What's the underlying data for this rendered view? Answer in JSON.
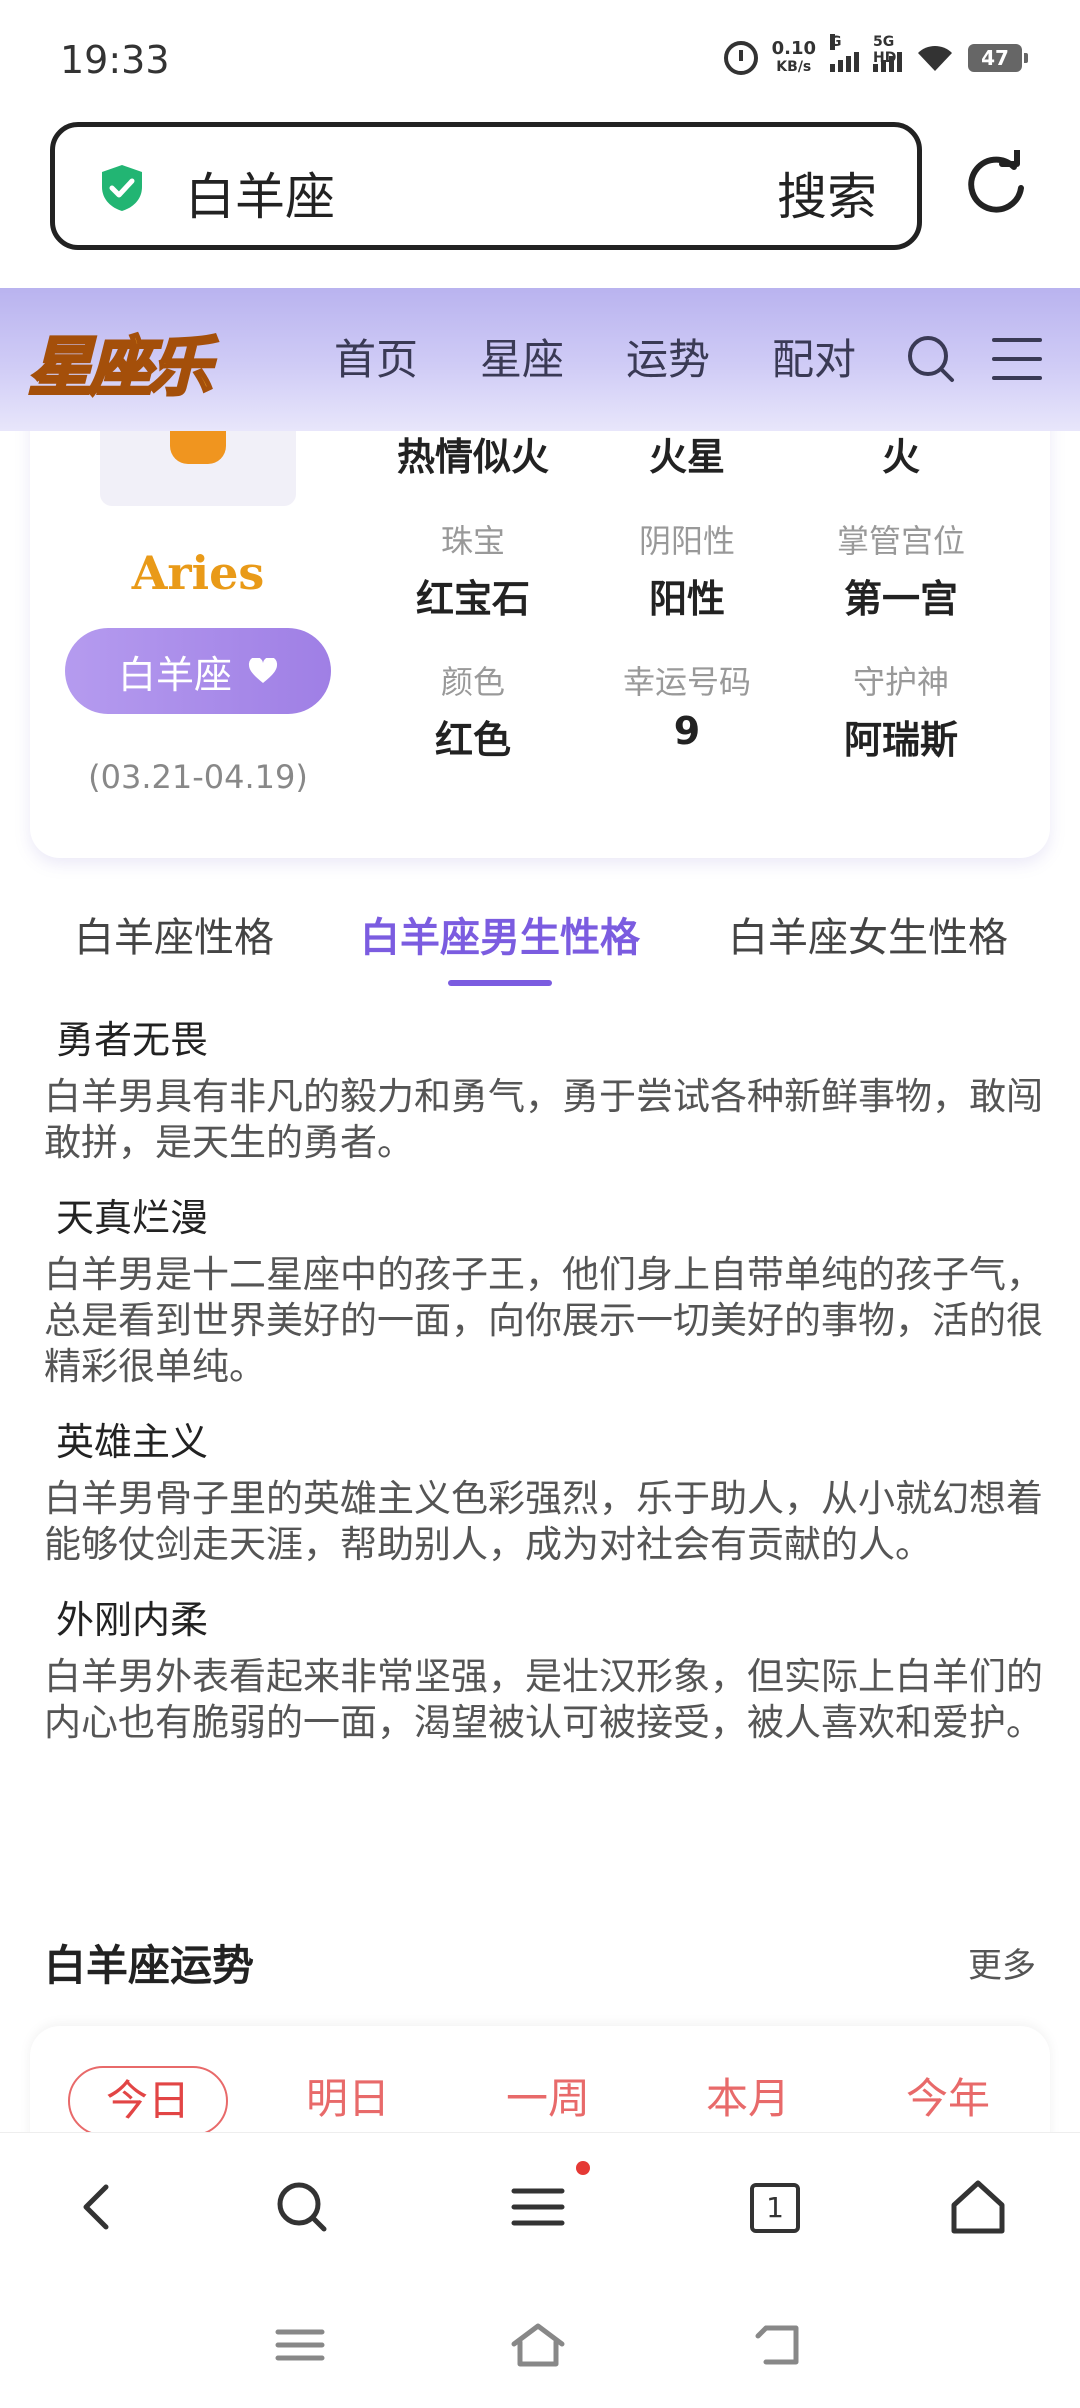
{
  "status_bar": {
    "time": "19:33",
    "net_speed_value": "0.10",
    "net_speed_unit": "KB/s",
    "sim1_label": "G",
    "sim2_label": "5G HD",
    "battery": "47"
  },
  "search": {
    "query": "白羊座",
    "button_label": "搜索"
  },
  "site": {
    "logo_text": "星座乐",
    "nav": [
      "首页",
      "星座",
      "运势",
      "配对"
    ]
  },
  "sign": {
    "english_name": "Aries",
    "chinese_name": "白羊座",
    "date_range": "(03.21-04.19)",
    "top_row_values": [
      "热情似火",
      "火星",
      "火"
    ],
    "attributes": [
      {
        "label": "珠宝",
        "value": "红宝石"
      },
      {
        "label": "阴阳性",
        "value": "阳性"
      },
      {
        "label": "掌管宫位",
        "value": "第一宫"
      },
      {
        "label": "颜色",
        "value": "红色"
      },
      {
        "label": "幸运号码",
        "value": "9"
      },
      {
        "label": "守护神",
        "value": "阿瑞斯"
      }
    ]
  },
  "tabs": {
    "items": [
      "白羊座性格",
      "白羊座男生性格",
      "白羊座女生性格"
    ],
    "active": "白羊座男生性格"
  },
  "traits": [
    {
      "title": "勇者无畏",
      "desc": "白羊男具有非凡的毅力和勇气，勇于尝试各种新鲜事物，敢闯敢拼，是天生的勇者。"
    },
    {
      "title": "天真烂漫",
      "desc": "白羊男是十二星座中的孩子王，他们身上自带单纯的孩子气，总是看到世界美好的一面，向你展示一切美好的事物，活的很精彩很单纯。"
    },
    {
      "title": "英雄主义",
      "desc": "白羊男骨子里的英雄主义色彩强烈，乐于助人，从小就幻想着能够仗剑走天涯，帮助别人，成为对社会有贡献的人。"
    },
    {
      "title": "外刚内柔",
      "desc": "白羊男外表看起来非常坚强，是壮汉形象，但实际上白羊们的内心也有脆弱的一面，渴望被认可被接受，被人喜欢和爱护。"
    }
  ],
  "fortune": {
    "title": "白羊座运势",
    "more": "更多",
    "tabs": [
      "今日",
      "明日",
      "一周",
      "本月",
      "今年"
    ],
    "active": "今日"
  },
  "browser_bar": {
    "tab_count": "1"
  },
  "colors": {
    "accent_purple": "#7b5ce0",
    "header_gradient": "#b9b3ef",
    "fortune_red": "#e86a6a",
    "aries_gold": "#e99a18"
  }
}
